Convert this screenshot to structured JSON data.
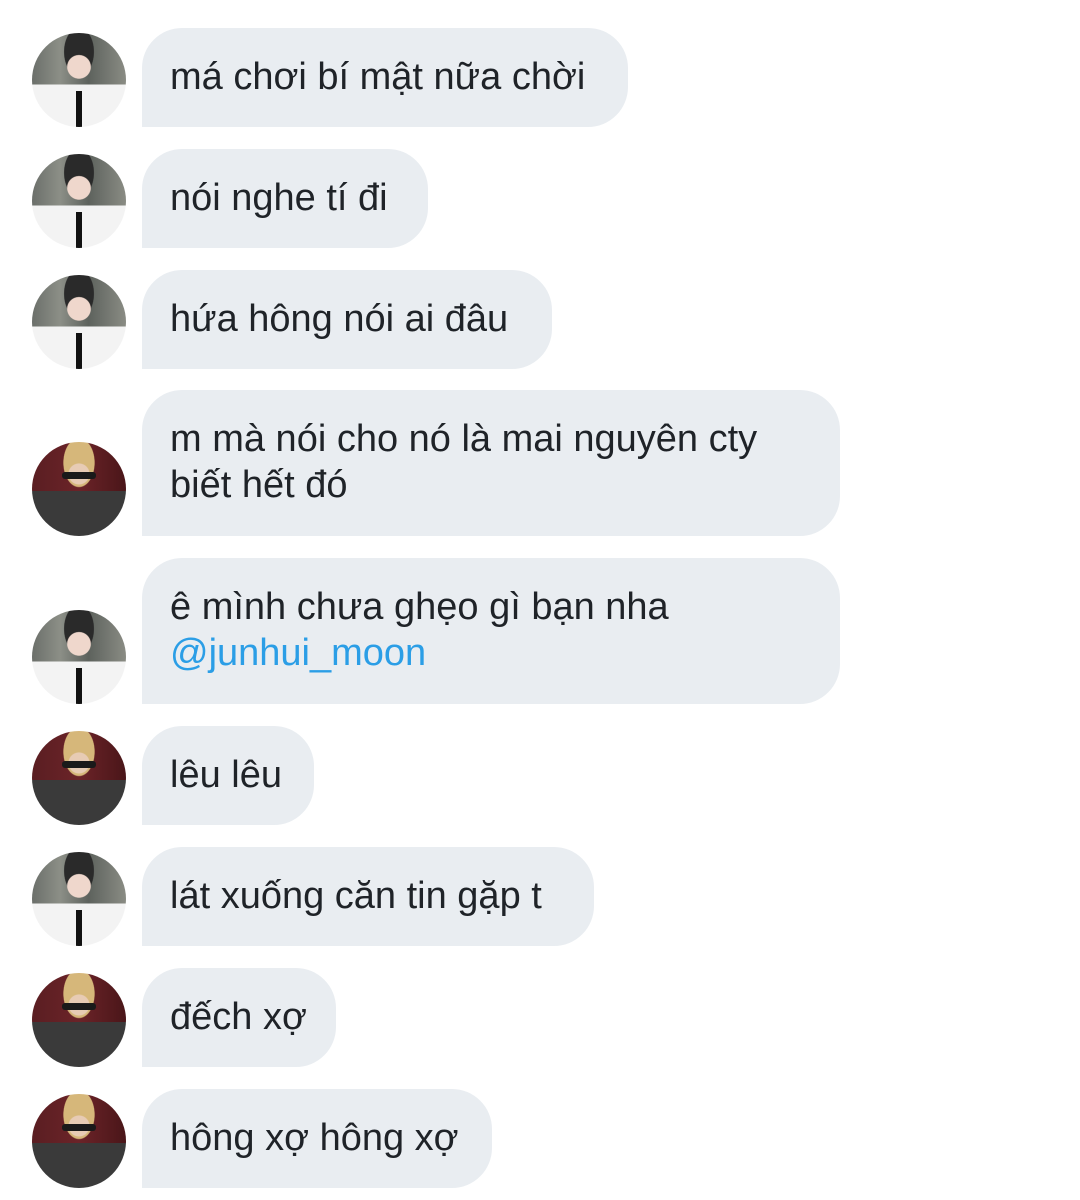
{
  "chat": {
    "messages": [
      {
        "sender": "A",
        "lines": [
          "má chơi bí mật nữa chời"
        ]
      },
      {
        "sender": "A",
        "lines": [
          "nói nghe tí đi"
        ]
      },
      {
        "sender": "A",
        "lines": [
          "hứa hông nói ai đâu"
        ]
      },
      {
        "sender": "B",
        "lines": [
          "m mà nói cho nó là mai nguyên cty",
          "biết hết đó"
        ]
      },
      {
        "sender": "A",
        "lines": [
          "ê mình chưa ghẹo gì bạn nha"
        ],
        "mention": "@junhui_moon"
      },
      {
        "sender": "B",
        "lines": [
          "lêu lêu"
        ]
      },
      {
        "sender": "A",
        "lines": [
          "lát xuống căn tin gặp t"
        ]
      },
      {
        "sender": "B",
        "lines": [
          "đếch xợ"
        ]
      },
      {
        "sender": "B",
        "lines": [
          "hông xợ hông xợ"
        ]
      }
    ]
  },
  "colors": {
    "bubble": "#e9edf1",
    "text": "#1f2328",
    "mention": "#2b9ee6"
  }
}
